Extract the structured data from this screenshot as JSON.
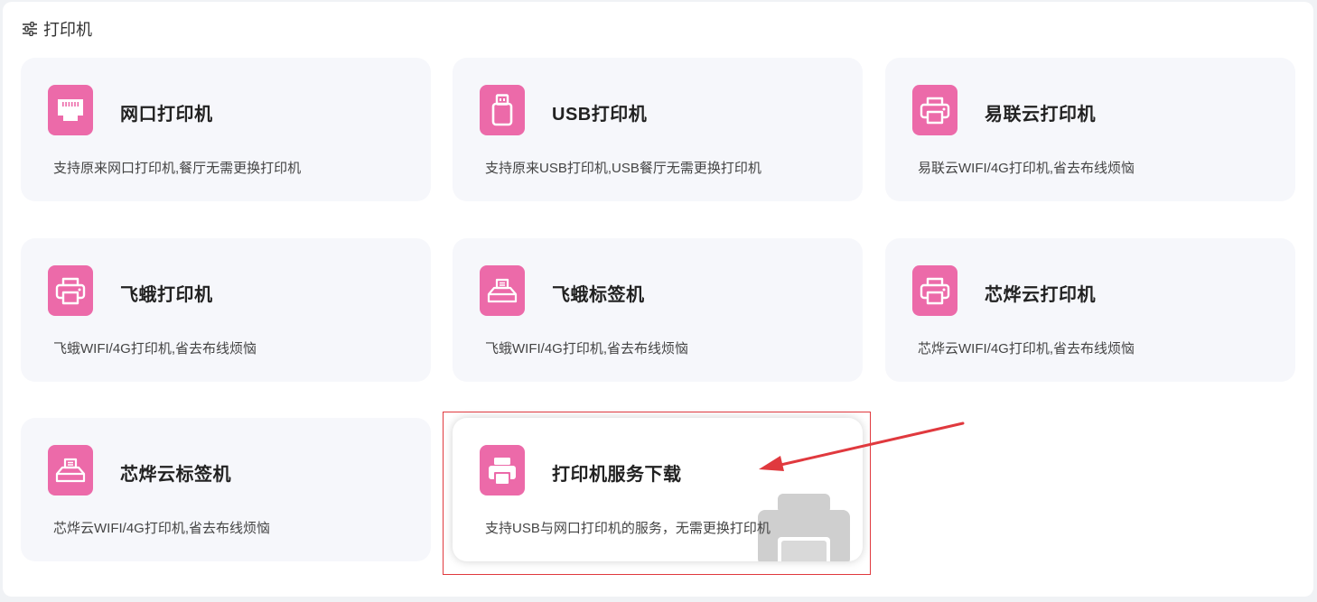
{
  "section": {
    "title": "打印机",
    "icon": "sliders-icon"
  },
  "cards": [
    {
      "title": "网口打印机",
      "desc": "支持原来网口打印机,餐厅无需更换打印机",
      "icon": "ethernet-port-icon"
    },
    {
      "title": "USB打印机",
      "desc": "支持原来USB打印机,USB餐厅无需更换打印机",
      "icon": "usb-drive-icon"
    },
    {
      "title": "易联云打印机",
      "desc": "易联云WIFI/4G打印机,省去布线烦恼",
      "icon": "printer-icon"
    },
    {
      "title": "飞蛾打印机",
      "desc": "飞蛾WIFI/4G打印机,省去布线烦恼",
      "icon": "printer-icon"
    },
    {
      "title": "飞蛾标签机",
      "desc": "飞蛾WIFI/4G打印机,省去布线烦恼",
      "icon": "label-printer-icon"
    },
    {
      "title": "芯烨云打印机",
      "desc": "芯烨云WIFI/4G打印机,省去布线烦恼",
      "icon": "printer-icon"
    },
    {
      "title": "芯烨云标签机",
      "desc": "芯烨云WIFI/4G打印机,省去布线烦恼",
      "icon": "label-printer-icon"
    },
    {
      "title": "打印机服务下载",
      "desc": "支持USB与网口打印机的服务，无需更换打印机",
      "icon": "printer-solid-icon"
    }
  ],
  "colors": {
    "accent": "#ec6aa9",
    "card_bg": "#f6f7fb",
    "annotation_red": "#e0393e"
  }
}
